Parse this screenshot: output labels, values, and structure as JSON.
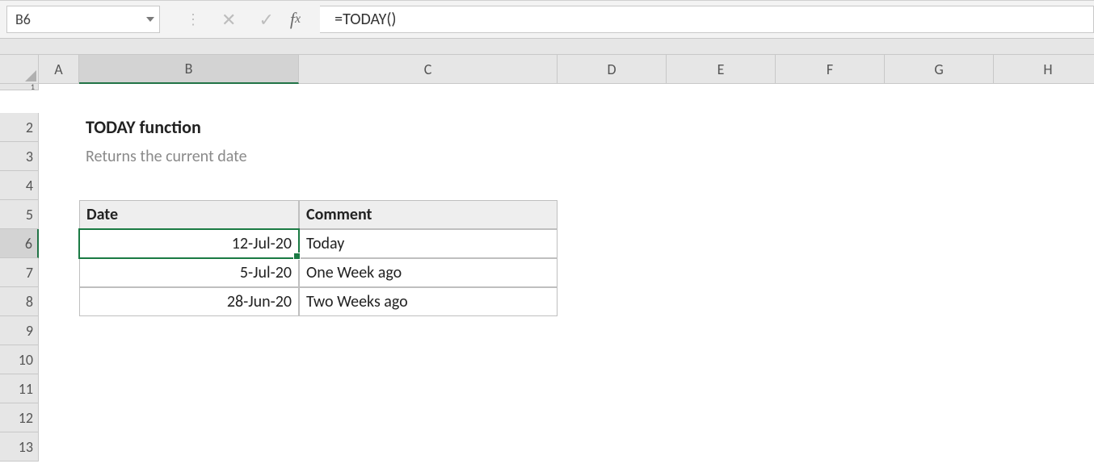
{
  "nameBox": {
    "value": "B6"
  },
  "formulaBar": {
    "value": "=TODAY()"
  },
  "columns": [
    "A",
    "B",
    "C",
    "D",
    "E",
    "F",
    "G",
    "H"
  ],
  "rows": [
    "1",
    "2",
    "3",
    "4",
    "5",
    "6",
    "7",
    "8",
    "9",
    "10",
    "11",
    "12",
    "13"
  ],
  "activeCol": "B",
  "activeRow": "6",
  "content": {
    "title": "TODAY function",
    "subtitle": "Returns the current date",
    "headers": {
      "date": "Date",
      "comment": "Comment"
    },
    "table": [
      {
        "date": "12-Jul-20",
        "comment": "Today"
      },
      {
        "date": "5-Jul-20",
        "comment": "One Week ago"
      },
      {
        "date": "28-Jun-20",
        "comment": "Two Weeks ago"
      }
    ]
  },
  "icons": {
    "cancel": "✕",
    "enter": "✓"
  }
}
